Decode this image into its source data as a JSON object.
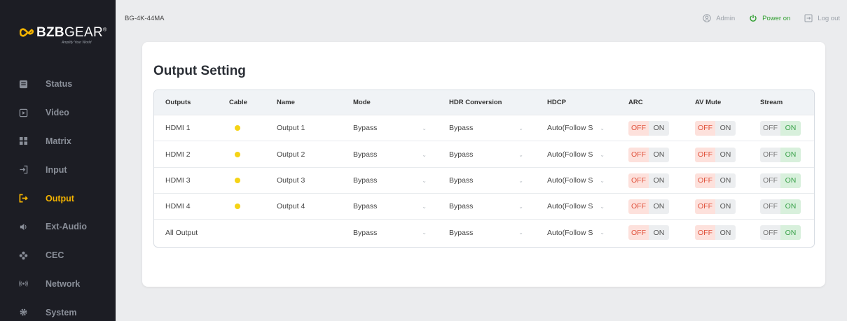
{
  "brand": {
    "name_bold": "BZB",
    "name_light": "GEAR",
    "reg": "®",
    "tagline": "Amplify Your World",
    "accent": "#f5b400"
  },
  "sidebar": {
    "items": [
      {
        "label": "Status",
        "icon": "status-icon",
        "active": false
      },
      {
        "label": "Video",
        "icon": "video-icon",
        "active": false
      },
      {
        "label": "Matrix",
        "icon": "matrix-icon",
        "active": false
      },
      {
        "label": "Input",
        "icon": "input-icon",
        "active": false
      },
      {
        "label": "Output",
        "icon": "output-icon",
        "active": true
      },
      {
        "label": "Ext-Audio",
        "icon": "speaker-icon",
        "active": false
      },
      {
        "label": "CEC",
        "icon": "cec-icon",
        "active": false
      },
      {
        "label": "Network",
        "icon": "network-icon",
        "active": false
      },
      {
        "label": "System",
        "icon": "gear-icon",
        "active": false
      }
    ]
  },
  "header": {
    "device": "BG-4K-44MA",
    "admin": "Admin",
    "power": "Power on",
    "logout": "Log out"
  },
  "main": {
    "title": "Output Setting",
    "columns": [
      "Outputs",
      "Cable",
      "Name",
      "Mode",
      "HDR Conversion",
      "HDCP",
      "ARC",
      "AV Mute",
      "Stream"
    ],
    "toggle_labels": {
      "off": "OFF",
      "on": "ON"
    },
    "rows": [
      {
        "output": "HDMI 1",
        "cable": true,
        "name": "Output 1",
        "mode": "Bypass",
        "hdr": "Bypass",
        "hdcp": "Auto(Follow S",
        "arc": "off",
        "av_mute": "off",
        "stream": "on"
      },
      {
        "output": "HDMI 2",
        "cable": true,
        "name": "Output 2",
        "mode": "Bypass",
        "hdr": "Bypass",
        "hdcp": "Auto(Follow S",
        "arc": "off",
        "av_mute": "off",
        "stream": "on"
      },
      {
        "output": "HDMI 3",
        "cable": true,
        "name": "Output 3",
        "mode": "Bypass",
        "hdr": "Bypass",
        "hdcp": "Auto(Follow S",
        "arc": "off",
        "av_mute": "off",
        "stream": "on"
      },
      {
        "output": "HDMI 4",
        "cable": true,
        "name": "Output 4",
        "mode": "Bypass",
        "hdr": "Bypass",
        "hdcp": "Auto(Follow S",
        "arc": "off",
        "av_mute": "off",
        "stream": "on"
      },
      {
        "output": "All Output",
        "cable": false,
        "name": "",
        "mode": "Bypass",
        "hdr": "Bypass",
        "hdcp": "Auto(Follow S",
        "arc": "off",
        "av_mute": "off",
        "stream": "on"
      }
    ]
  }
}
